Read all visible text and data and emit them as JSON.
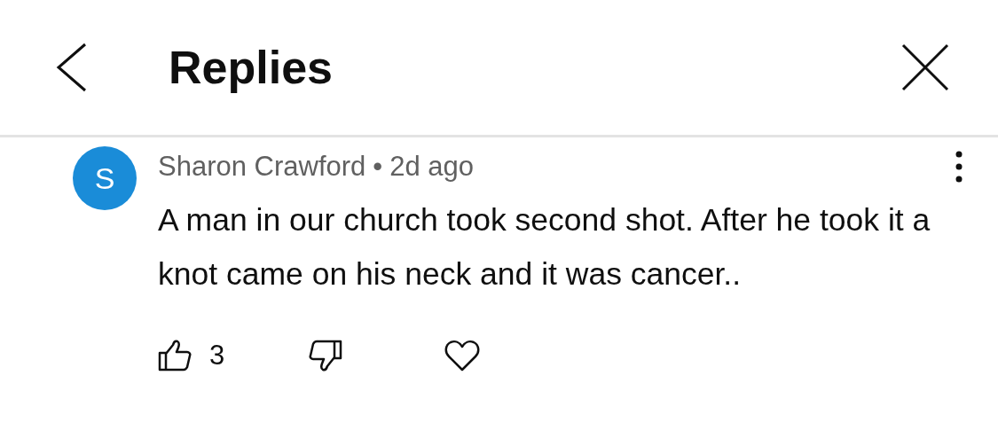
{
  "header": {
    "title": "Replies"
  },
  "comment": {
    "avatar_letter": "S",
    "author": "Sharon Crawford",
    "separator": "•",
    "time": "2d ago",
    "text": "A man in our church took second shot. After he took it a knot came on his neck and it was cancer..",
    "likes": "3"
  }
}
